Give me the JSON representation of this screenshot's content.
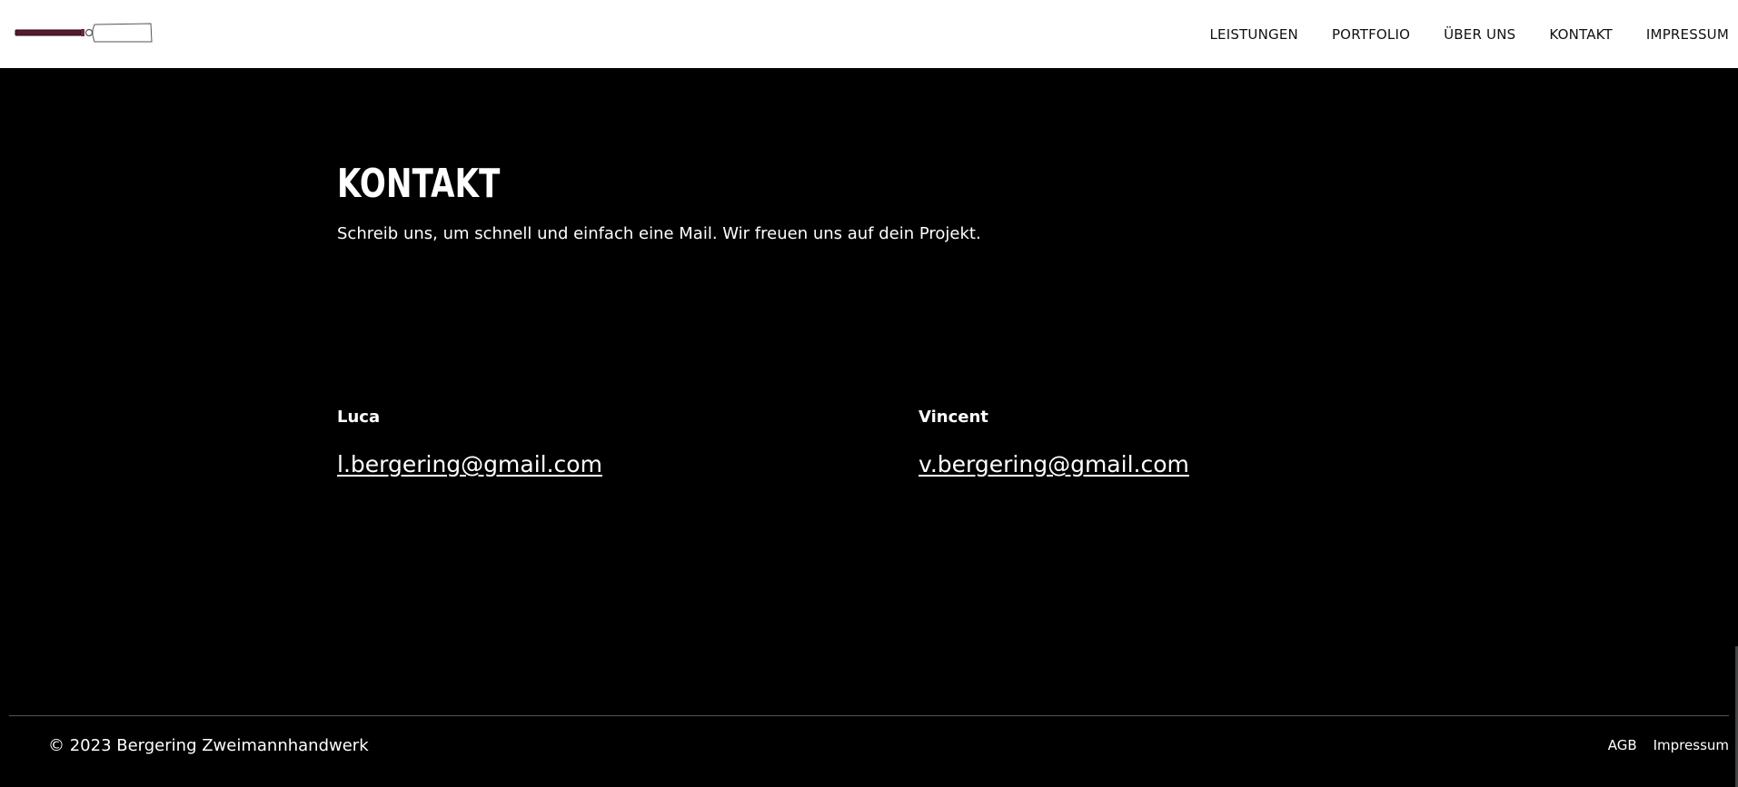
{
  "header": {
    "logo_name": "chisel-logo",
    "nav": [
      "LEISTUNGEN",
      "PORTFOLIO",
      "ÜBER UNS",
      "KONTAKT",
      "IMPRESSUM"
    ]
  },
  "main": {
    "title": "KONTAKT",
    "subtitle": "Schreib uns, um schnell und einfach eine Mail. Wir freuen uns auf dein Projekt.",
    "contacts": [
      {
        "name": "Luca",
        "email": "l.bergering@gmail.com"
      },
      {
        "name": "Vincent",
        "email": "v.bergering@gmail.com"
      }
    ]
  },
  "footer": {
    "copyright": "© 2023 Bergering Zweimannhandwerk",
    "links": [
      "AGB",
      "Impressum"
    ]
  },
  "colors": {
    "background": "#000000",
    "header_bg": "#ffffff",
    "logo_handle": "#5a1a2e",
    "text": "#ffffff"
  }
}
